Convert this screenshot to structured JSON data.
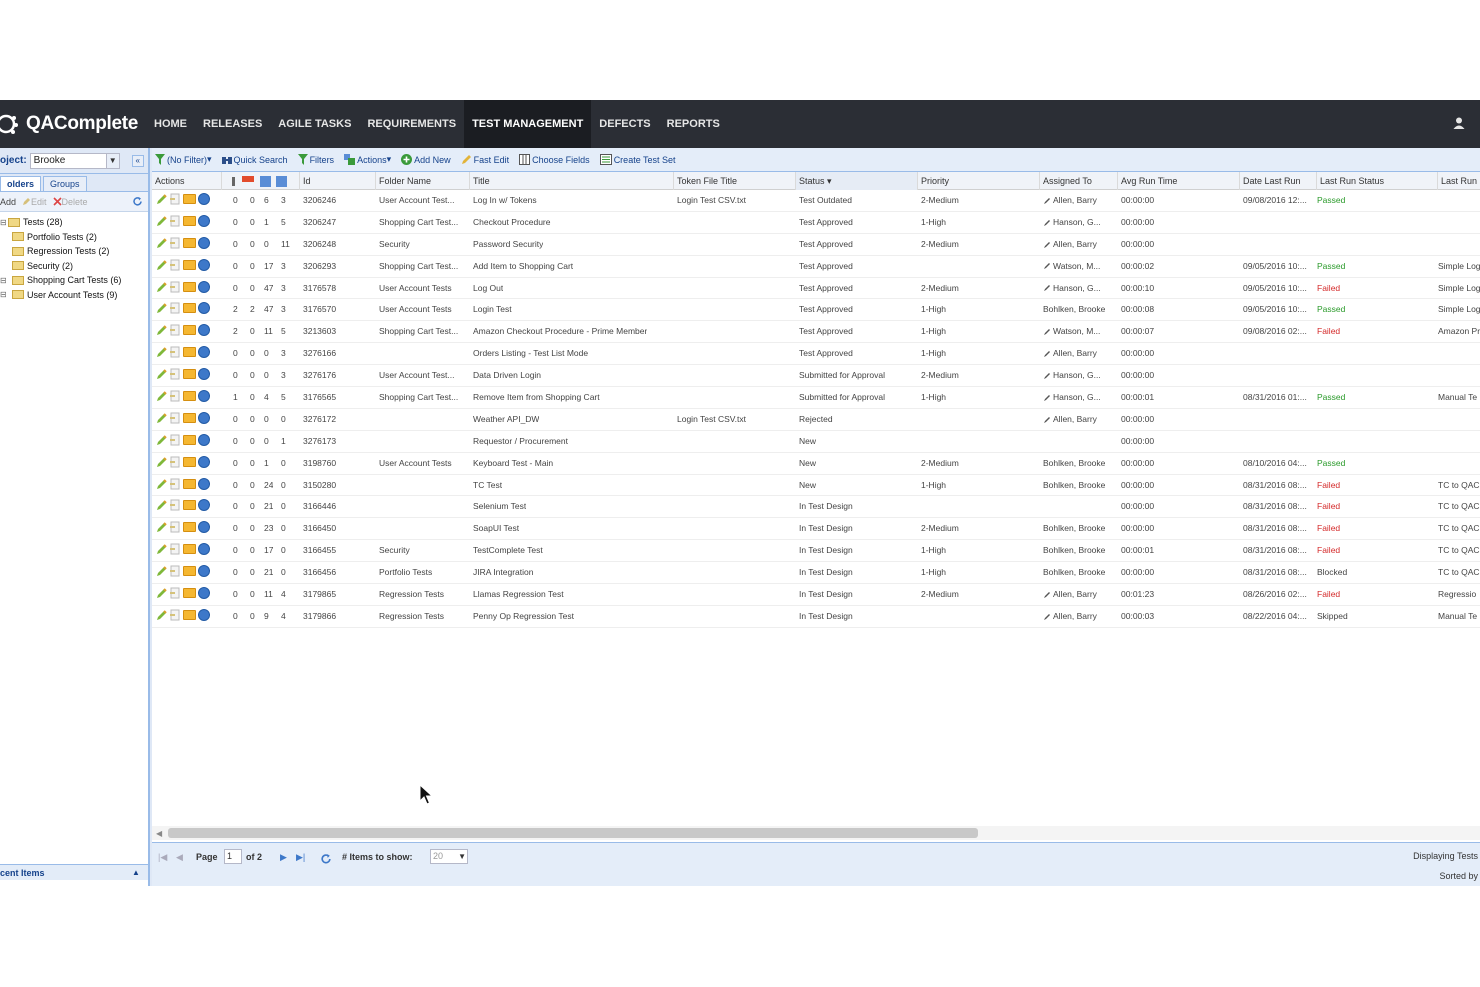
{
  "app": {
    "logo": "QAComplete"
  },
  "nav": {
    "items": [
      {
        "label": "HOME",
        "active": false
      },
      {
        "label": "RELEASES",
        "active": false
      },
      {
        "label": "AGILE TASKS",
        "active": false
      },
      {
        "label": "REQUIREMENTS",
        "active": false
      },
      {
        "label": "TEST MANAGEMENT",
        "active": true
      },
      {
        "label": "DEFECTS",
        "active": false
      },
      {
        "label": "REPORTS",
        "active": false
      }
    ]
  },
  "left": {
    "project_label": "oject:",
    "project_value": "Brooke",
    "tabs": [
      "olders",
      "Groups"
    ],
    "toolbar": {
      "add": "Add",
      "edit": "Edit",
      "delete": "Delete"
    },
    "tree": [
      {
        "label": "Tests (28)",
        "level": 0
      },
      {
        "label": "Portfolio Tests (2)",
        "level": 1
      },
      {
        "label": "Regression Tests (2)",
        "level": 1
      },
      {
        "label": "Security (2)",
        "level": 1
      },
      {
        "label": "Shopping Cart Tests (6)",
        "level": 1
      },
      {
        "label": "User Account Tests (9)",
        "level": 1
      }
    ],
    "recent": "cent Items"
  },
  "toolbar": {
    "filter": "(No Filter)",
    "quick_search": "Quick Search",
    "filters": "Filters",
    "actions": "Actions",
    "add_new": "Add New",
    "fast_edit": "Fast Edit",
    "choose_fields": "Choose Fields",
    "create_test_set": "Create Test Set"
  },
  "columns": {
    "actions": "Actions",
    "id": "Id",
    "folder": "Folder Name",
    "title": "Title",
    "token": "Token File Title",
    "status": "Status",
    "priority": "Priority",
    "assigned": "Assigned To",
    "avg": "Avg Run Time",
    "date": "Date Last Run",
    "last_status": "Last Run Status",
    "last_run": "Last Run"
  },
  "rows": [
    {
      "n1": "0",
      "n2": "0",
      "n3": "6",
      "n4": "3",
      "id": "3206246",
      "folder": "User Account Test...",
      "title": "Log In w/ Tokens",
      "token": "Login Test CSV.txt",
      "status": "Test Outdated",
      "priority": "2-Medium",
      "assigned": "Allen, Barry",
      "assigned_edit": true,
      "avg": "00:00:00",
      "date": "09/08/2016 12:...",
      "last_status": "Passed",
      "last_run": ""
    },
    {
      "n1": "0",
      "n2": "0",
      "n3": "1",
      "n4": "5",
      "id": "3206247",
      "folder": "Shopping Cart Test...",
      "title": "Checkout Procedure",
      "token": "",
      "status": "Test Approved",
      "priority": "1-High",
      "assigned": "Hanson, G...",
      "assigned_edit": true,
      "avg": "00:00:00",
      "date": "",
      "last_status": "",
      "last_run": ""
    },
    {
      "n1": "0",
      "n2": "0",
      "n3": "0",
      "n4": "11",
      "id": "3206248",
      "folder": "Security",
      "title": "Password Security",
      "token": "",
      "status": "Test Approved",
      "priority": "2-Medium",
      "assigned": "Allen, Barry",
      "assigned_edit": true,
      "avg": "00:00:00",
      "date": "",
      "last_status": "",
      "last_run": ""
    },
    {
      "n1": "0",
      "n2": "0",
      "n3": "17",
      "n4": "3",
      "id": "3206293",
      "folder": "Shopping Cart Test...",
      "title": "Add Item to Shopping Cart",
      "token": "",
      "status": "Test Approved",
      "priority": "",
      "assigned": "Watson, M...",
      "assigned_edit": true,
      "avg": "00:00:02",
      "date": "09/05/2016 10:...",
      "last_status": "Passed",
      "last_run": "Simple Log"
    },
    {
      "n1": "0",
      "n2": "0",
      "n3": "47",
      "n4": "3",
      "id": "3176578",
      "folder": "User Account Tests",
      "title": "Log Out",
      "token": "",
      "status": "Test Approved",
      "priority": "2-Medium",
      "assigned": "Hanson, G...",
      "assigned_edit": true,
      "avg": "00:00:10",
      "date": "09/05/2016 10:...",
      "last_status": "Failed",
      "last_run": "Simple Log"
    },
    {
      "n1": "2",
      "n2": "2",
      "n3": "47",
      "n4": "3",
      "id": "3176570",
      "folder": "User Account Tests",
      "title": "Login Test",
      "token": "",
      "status": "Test Approved",
      "priority": "1-High",
      "assigned": "Bohlken, Brooke",
      "assigned_edit": false,
      "avg": "00:00:08",
      "date": "09/05/2016 10:...",
      "last_status": "Passed",
      "last_run": "Simple Log"
    },
    {
      "n1": "2",
      "n2": "0",
      "n3": "11",
      "n4": "5",
      "id": "3213603",
      "folder": "Shopping Cart Test...",
      "title": "Amazon Checkout Procedure - Prime Member",
      "token": "",
      "status": "Test Approved",
      "priority": "1-High",
      "assigned": "Watson, M...",
      "assigned_edit": true,
      "avg": "00:00:07",
      "date": "09/08/2016 02:...",
      "last_status": "Failed",
      "last_run": "Amazon Pr"
    },
    {
      "n1": "0",
      "n2": "0",
      "n3": "0",
      "n4": "3",
      "id": "3276166",
      "folder": "",
      "title": "Orders Listing - Test List Mode",
      "token": "",
      "status": "Test Approved",
      "priority": "1-High",
      "assigned": "Allen, Barry",
      "assigned_edit": true,
      "avg": "00:00:00",
      "date": "",
      "last_status": "",
      "last_run": ""
    },
    {
      "n1": "0",
      "n2": "0",
      "n3": "0",
      "n4": "3",
      "id": "3276176",
      "folder": "User Account Test...",
      "title": "Data Driven Login",
      "token": "",
      "status": "Submitted for Approval",
      "priority": "2-Medium",
      "assigned": "Hanson, G...",
      "assigned_edit": true,
      "avg": "00:00:00",
      "date": "",
      "last_status": "",
      "last_run": ""
    },
    {
      "n1": "1",
      "n2": "0",
      "n3": "4",
      "n4": "5",
      "id": "3176565",
      "folder": "Shopping Cart Test...",
      "title": "Remove Item from Shopping Cart",
      "token": "",
      "status": "Submitted for Approval",
      "priority": "1-High",
      "assigned": "Hanson, G...",
      "assigned_edit": true,
      "avg": "00:00:01",
      "date": "08/31/2016 01:...",
      "last_status": "Passed",
      "last_run": "Manual Te"
    },
    {
      "n1": "0",
      "n2": "0",
      "n3": "0",
      "n4": "0",
      "id": "3276172",
      "folder": "",
      "title": "Weather API_DW",
      "token": "Login Test CSV.txt",
      "status": "Rejected",
      "priority": "",
      "assigned": "Allen, Barry",
      "assigned_edit": true,
      "avg": "00:00:00",
      "date": "",
      "last_status": "",
      "last_run": ""
    },
    {
      "n1": "0",
      "n2": "0",
      "n3": "0",
      "n4": "1",
      "id": "3276173",
      "folder": "",
      "title": "Requestor / Procurement",
      "token": "",
      "status": "New",
      "priority": "",
      "assigned": "",
      "assigned_edit": false,
      "avg": "00:00:00",
      "date": "",
      "last_status": "",
      "last_run": ""
    },
    {
      "n1": "0",
      "n2": "0",
      "n3": "1",
      "n4": "0",
      "id": "3198760",
      "folder": "User Account Tests",
      "title": "Keyboard Test - Main",
      "token": "",
      "status": "New",
      "priority": "2-Medium",
      "assigned": "Bohlken, Brooke",
      "assigned_edit": false,
      "avg": "00:00:00",
      "date": "08/10/2016 04:...",
      "last_status": "Passed",
      "last_run": ""
    },
    {
      "n1": "0",
      "n2": "0",
      "n3": "24",
      "n4": "0",
      "id": "3150280",
      "folder": "",
      "title": "TC Test",
      "token": "",
      "status": "New",
      "priority": "1-High",
      "assigned": "Bohlken, Brooke",
      "assigned_edit": false,
      "avg": "00:00:00",
      "date": "08/31/2016 08:...",
      "last_status": "Failed",
      "last_run": "TC to QAC"
    },
    {
      "n1": "0",
      "n2": "0",
      "n3": "21",
      "n4": "0",
      "id": "3166446",
      "folder": "",
      "title": "Selenium Test",
      "token": "",
      "status": "In Test Design",
      "priority": "",
      "assigned": "",
      "assigned_edit": false,
      "avg": "00:00:00",
      "date": "08/31/2016 08:...",
      "last_status": "Failed",
      "last_run": "TC to QAC"
    },
    {
      "n1": "0",
      "n2": "0",
      "n3": "23",
      "n4": "0",
      "id": "3166450",
      "folder": "",
      "title": "SoapUI Test",
      "token": "",
      "status": "In Test Design",
      "priority": "2-Medium",
      "assigned": "Bohlken, Brooke",
      "assigned_edit": false,
      "avg": "00:00:00",
      "date": "08/31/2016 08:...",
      "last_status": "Failed",
      "last_run": "TC to QAC"
    },
    {
      "n1": "0",
      "n2": "0",
      "n3": "17",
      "n4": "0",
      "id": "3166455",
      "folder": "Security",
      "title": "TestComplete Test",
      "token": "",
      "status": "In Test Design",
      "priority": "1-High",
      "assigned": "Bohlken, Brooke",
      "assigned_edit": false,
      "avg": "00:00:01",
      "date": "08/31/2016 08:...",
      "last_status": "Failed",
      "last_run": "TC to QAC"
    },
    {
      "n1": "0",
      "n2": "0",
      "n3": "21",
      "n4": "0",
      "id": "3166456",
      "folder": "Portfolio Tests",
      "title": "JIRA Integration",
      "token": "",
      "status": "In Test Design",
      "priority": "1-High",
      "assigned": "Bohlken, Brooke",
      "assigned_edit": false,
      "avg": "00:00:00",
      "date": "08/31/2016 08:...",
      "last_status": "Blocked",
      "last_run": "TC to QAC"
    },
    {
      "n1": "0",
      "n2": "0",
      "n3": "11",
      "n4": "4",
      "id": "3179865",
      "folder": "Regression Tests",
      "title": "Llamas Regression Test",
      "token": "",
      "status": "In Test Design",
      "priority": "2-Medium",
      "assigned": "Allen, Barry",
      "assigned_edit": true,
      "avg": "00:01:23",
      "date": "08/26/2016 02:...",
      "last_status": "Failed",
      "last_run": "Regressio"
    },
    {
      "n1": "0",
      "n2": "0",
      "n3": "9",
      "n4": "4",
      "id": "3179866",
      "folder": "Regression Tests",
      "title": "Penny Op Regression Test",
      "token": "",
      "status": "In Test Design",
      "priority": "",
      "assigned": "Allen, Barry",
      "assigned_edit": true,
      "avg": "00:00:03",
      "date": "08/22/2016 04:...",
      "last_status": "Skipped",
      "last_run": "Manual Te"
    }
  ],
  "paging": {
    "page_label": "Page",
    "page_value": "1",
    "of_label": "of 2",
    "items_label": "# Items to show:",
    "items_value": "20",
    "displaying": "Displaying Tests",
    "sorted": "Sorted by"
  },
  "colors": {
    "nav_bg": "#2b2e35",
    "accent": "#15428b",
    "passed": "#2a9a2a",
    "failed": "#d42a2a"
  }
}
